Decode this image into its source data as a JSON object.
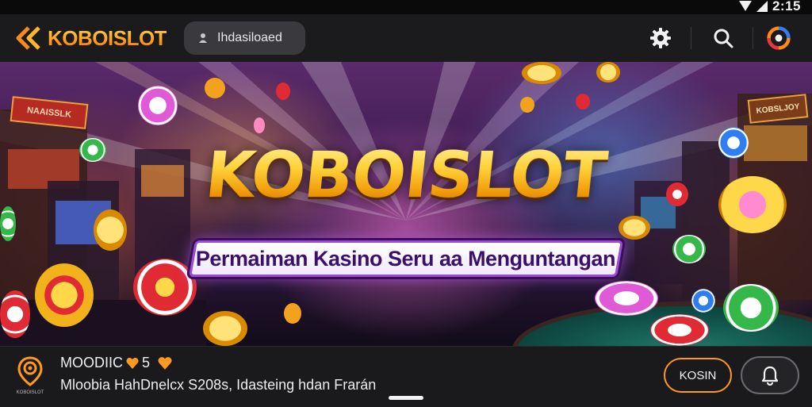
{
  "status_bar": {
    "time": "2:15"
  },
  "header": {
    "logo_text": "KOBOISLOT",
    "search": {
      "label": "Ihdasiloaed"
    }
  },
  "banner": {
    "title": "KOBOISLOT",
    "subtitle": "Permaiman Kasino Seru aa Menguntangan",
    "sign_left": "NAAISSLK",
    "sign_right": "KOBSLJOY"
  },
  "bottom": {
    "app_name": "MOODIIC",
    "rating": "5",
    "description": "Mloobia HahDnelcx S208s, Idasteing hdan Frarán",
    "action_button": "KOSIN",
    "icon_caption": "KOBOISLOT"
  },
  "colors": {
    "accent": "#ff9a1f",
    "gold": "#ffd23a",
    "header_bg": "#1b1a1d",
    "ribbon_border": "#9a4bd8"
  },
  "icons": {
    "logo": "double-chevron-icon",
    "search_pill": "person-icon",
    "settings": "gear-icon",
    "search": "search-icon",
    "profile": "ring-avatar-icon",
    "bell": "bell-icon",
    "rating": "heart-icon"
  }
}
